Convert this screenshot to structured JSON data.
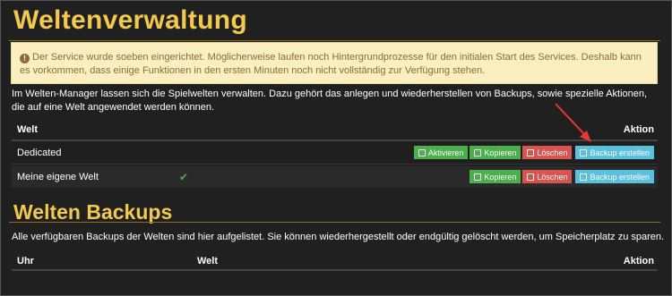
{
  "page": {
    "title": "Weltenverwaltung",
    "alert": "Der Service wurde soeben eingerichtet. Möglicherweise laufen noch Hintergrundprozesse für den initialen Start des Services. Deshalb kann es vorkommen, dass einige Funktionen in den ersten Minuten noch nicht vollständig zur Verfügung stehen.",
    "intro": "Im Welten-Manager lassen sich die Spielwelten verwalten. Dazu gehört das anlegen und wiederherstellen von Backups, sowie spezielle Aktionen, die auf eine Welt angewendet werden können."
  },
  "worlds_table": {
    "headers": {
      "world": "Welt",
      "action": "Aktion"
    },
    "rows": [
      {
        "name": "Dedicated",
        "active": false
      },
      {
        "name": "Meine eigene Welt",
        "active": true
      }
    ]
  },
  "actions": {
    "activate": "Aktivieren",
    "copy": "Kopieren",
    "delete": "Löschen",
    "backup": "Backup erstellen"
  },
  "backups": {
    "title": "Welten Backups",
    "description": "Alle verfügbaren Backups der Welten sind hier aufgelistet. Sie können wiederhergestellt oder endgültig gelöscht werden, um Speicherplatz zu sparen.",
    "headers": {
      "time": "Uhr",
      "world": "Welt",
      "action": "Aktion"
    }
  },
  "colors": {
    "accent": "#f2c94c",
    "success": "#4cae4c",
    "danger": "#d9534f",
    "info": "#5bc0de",
    "annotation_arrow": "#e53935"
  }
}
